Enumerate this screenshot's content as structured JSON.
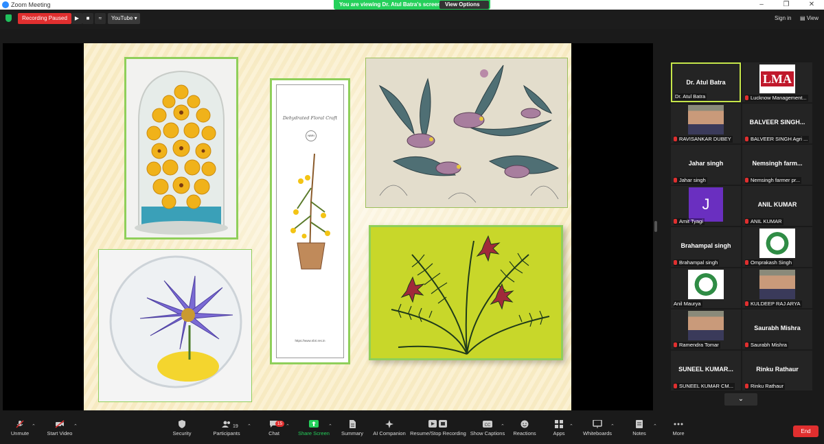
{
  "window": {
    "title": "Zoom Meeting"
  },
  "banner": {
    "viewing": "You are viewing Dr. Atul Batra's screen",
    "view_options": "View Options"
  },
  "topbar": {
    "recording_status": "Recording Paused",
    "youtube_label": "YouTube",
    "sign_in": "Sign in",
    "view": "View"
  },
  "slide": {
    "bookmark_title": "Dehydrated Floral Craft",
    "bookmark_logo": "NBRI",
    "bookmark_url": "https://www.nbri.res.in"
  },
  "participants": [
    {
      "display": "Dr. Atul Batra",
      "caption": "Dr. Atul Batra",
      "muted": false,
      "active": true,
      "type": "name"
    },
    {
      "display": "LMA",
      "caption": "Lucknow Management...",
      "muted": true,
      "type": "logo"
    },
    {
      "display": "",
      "caption": "RAVISANKAR DUBEY",
      "muted": true,
      "type": "photo"
    },
    {
      "display": "BALVEER SINGH...",
      "caption": "BALVEER SINGH Agri ...",
      "muted": true,
      "type": "name"
    },
    {
      "display": "Jahar singh",
      "caption": "Jahar singh",
      "muted": true,
      "type": "name"
    },
    {
      "display": "Nemsingh farm...",
      "caption": "Nemsingh farmer pr...",
      "muted": true,
      "type": "name"
    },
    {
      "display": "J",
      "caption": "Amit Tyagi",
      "muted": true,
      "type": "avatar"
    },
    {
      "display": "ANIL KUMAR",
      "caption": "ANIL KUMAR",
      "muted": true,
      "type": "name"
    },
    {
      "display": "Brahampal singh",
      "caption": "Brahampal singh",
      "muted": true,
      "type": "name"
    },
    {
      "display": "",
      "caption": "Omprakash Singh",
      "muted": true,
      "type": "logo"
    },
    {
      "display": "",
      "caption": "Anil Maurya",
      "muted": false,
      "type": "logo"
    },
    {
      "display": "",
      "caption": "KULDEEP RAJ ARYA",
      "muted": true,
      "type": "photo"
    },
    {
      "display": "",
      "caption": "Ramendra Tomar",
      "muted": true,
      "type": "photo"
    },
    {
      "display": "Saurabh Mishra",
      "caption": "Saurabh Mishra",
      "muted": true,
      "type": "name"
    },
    {
      "display": "SUNEEL KUMAR...",
      "caption": "SUNEEL KUMAR CM...",
      "muted": true,
      "type": "name"
    },
    {
      "display": "Rinku Rathaur",
      "caption": "Rinku Rathaur",
      "muted": true,
      "type": "name"
    }
  ],
  "toolbar": {
    "unmute": "Unmute",
    "start_video": "Start Video",
    "security": "Security",
    "participants": "Participants",
    "participant_count": "19",
    "chat": "Chat",
    "chat_badge": "15",
    "share_screen": "Share Screen",
    "summary": "Summary",
    "ai_companion": "AI Companion",
    "resume_stop_recording": "Resume/Stop Recording",
    "show_captions": "Show Captions",
    "reactions": "Reactions",
    "apps": "Apps",
    "whiteboards": "Whiteboards",
    "notes": "Notes",
    "more": "More",
    "end": "End"
  },
  "colors": {
    "accent_green": "#25d05b",
    "end_red": "#e02f2f",
    "active_border": "#c6e64a"
  }
}
